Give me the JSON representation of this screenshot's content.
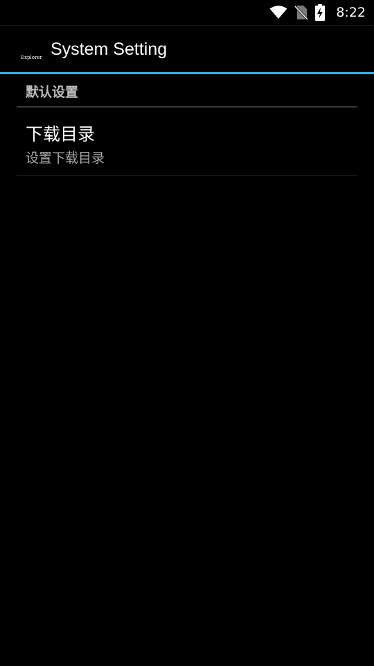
{
  "status_bar": {
    "time": "8:22",
    "icons": [
      "wifi-icon",
      "no-sim-icon",
      "battery-charging-icon"
    ]
  },
  "action_bar": {
    "logo_text": "Explorer",
    "title": "System Setting",
    "accent_color": "#33b5e5"
  },
  "preferences": {
    "category_title": "默认设置",
    "items": [
      {
        "title": "下载目录",
        "summary": "设置下载目录"
      }
    ]
  }
}
